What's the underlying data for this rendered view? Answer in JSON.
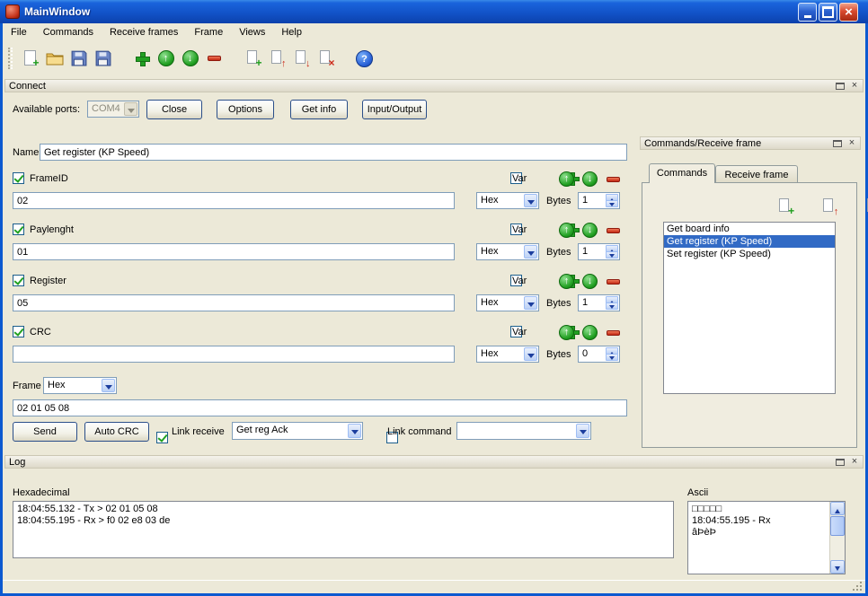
{
  "window": {
    "title": "MainWindow"
  },
  "menu": {
    "items": [
      "File",
      "Commands",
      "Receive frames",
      "Frame",
      "Views",
      "Help"
    ]
  },
  "toolbar": {
    "icons": [
      "new-frame",
      "open",
      "save",
      "save-as",
      "add-field",
      "move-field-up",
      "move-field-down",
      "remove-field",
      "add-command",
      "command-up",
      "command-down",
      "delete-command",
      "help"
    ]
  },
  "connect": {
    "title": "Connect",
    "ports_label": "Available ports:",
    "port_value": "COM4",
    "close_label": "Close",
    "options_label": "Options",
    "get_info_label": "Get info",
    "input_output_label": "Input/Output"
  },
  "frame_editor": {
    "name_label": "Name",
    "name_value": "Get register (KP Speed)",
    "var_label": "Var",
    "bytes_label": "Bytes",
    "fields": [
      {
        "label": "FrameID",
        "value": "02",
        "type": "Hex",
        "bytes": "1",
        "checked": true
      },
      {
        "label": "Paylenght",
        "value": "01",
        "type": "Hex",
        "bytes": "1",
        "checked": true
      },
      {
        "label": "Register",
        "value": "05",
        "type": "Hex",
        "bytes": "1",
        "checked": true
      },
      {
        "label": "CRC",
        "value": "",
        "type": "Hex",
        "bytes": "0",
        "checked": true
      }
    ],
    "frame_label": "Frame",
    "frame_type": "Hex",
    "frame_value": "02 01 05 08",
    "send_label": "Send",
    "auto_crc_label": "Auto CRC",
    "link_receive_label": "Link receive",
    "receive_frame_value": "Get reg Ack",
    "link_command_label": "Link command",
    "link_command_value": ""
  },
  "commands_panel": {
    "title": "Commands/Receive frame",
    "tabs": [
      "Commands",
      "Receive frame"
    ],
    "icons": [
      "add-command",
      "command-up",
      "command-down",
      "delete-command"
    ],
    "items": [
      "Get board info",
      "Get register (KP Speed)",
      "Set register (KP Speed)"
    ],
    "selected_item": "Get register (KP Speed)"
  },
  "log": {
    "title": "Log",
    "hex_label": "Hexadecimal",
    "hex_lines": [
      "18:04:55.132 - Tx > 02 01 05 08",
      "18:04:55.195 - Rx > f0 02 e8 03 de"
    ],
    "ascii_label": "Ascii",
    "ascii_lines": [
      "□□□□□",
      "18:04:55.195 - Rx",
      "âÞèÞ"
    ]
  }
}
